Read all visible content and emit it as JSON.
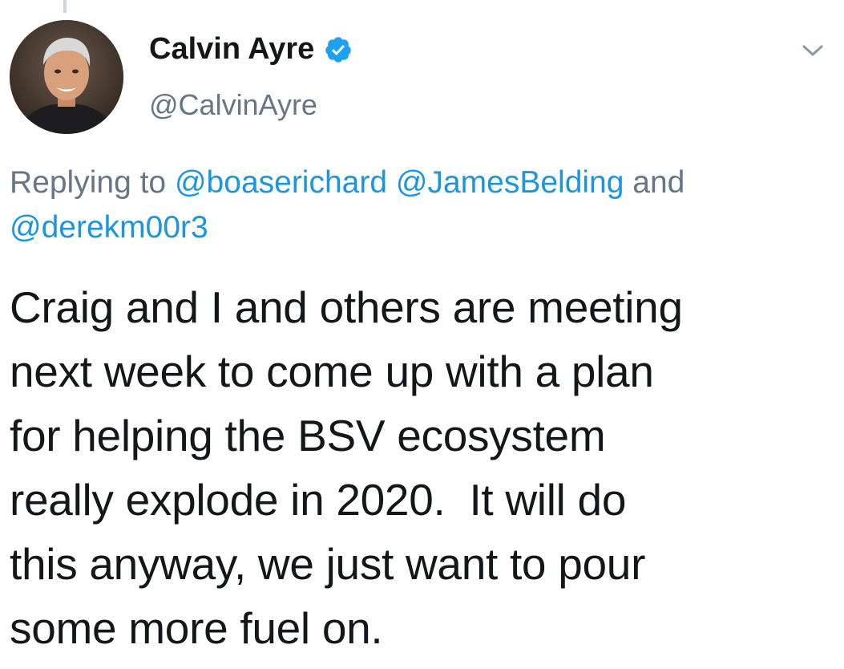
{
  "author": {
    "display_name": "Calvin Ayre",
    "handle": "@CalvinAyre",
    "verified": true
  },
  "reply": {
    "prefix": "Replying to",
    "mentions": [
      "@boaserichard",
      "@JamesBelding",
      "@derekm00r3"
    ],
    "conjunction": "and"
  },
  "tweet": {
    "lines": [
      "Craig and I and others are meeting",
      "next week to come up with a plan",
      "for helping the BSV ecosystem",
      "really explode in 2020.  It will do",
      "this anyway, we just want to pour",
      "some more fuel on."
    ]
  },
  "colors": {
    "text": "#14171a",
    "secondary": "#657786",
    "link": "#1b95e0",
    "verified": "#1da1f2"
  },
  "icons": {
    "verified": "verified-badge-icon",
    "caret": "chevron-down-icon"
  }
}
